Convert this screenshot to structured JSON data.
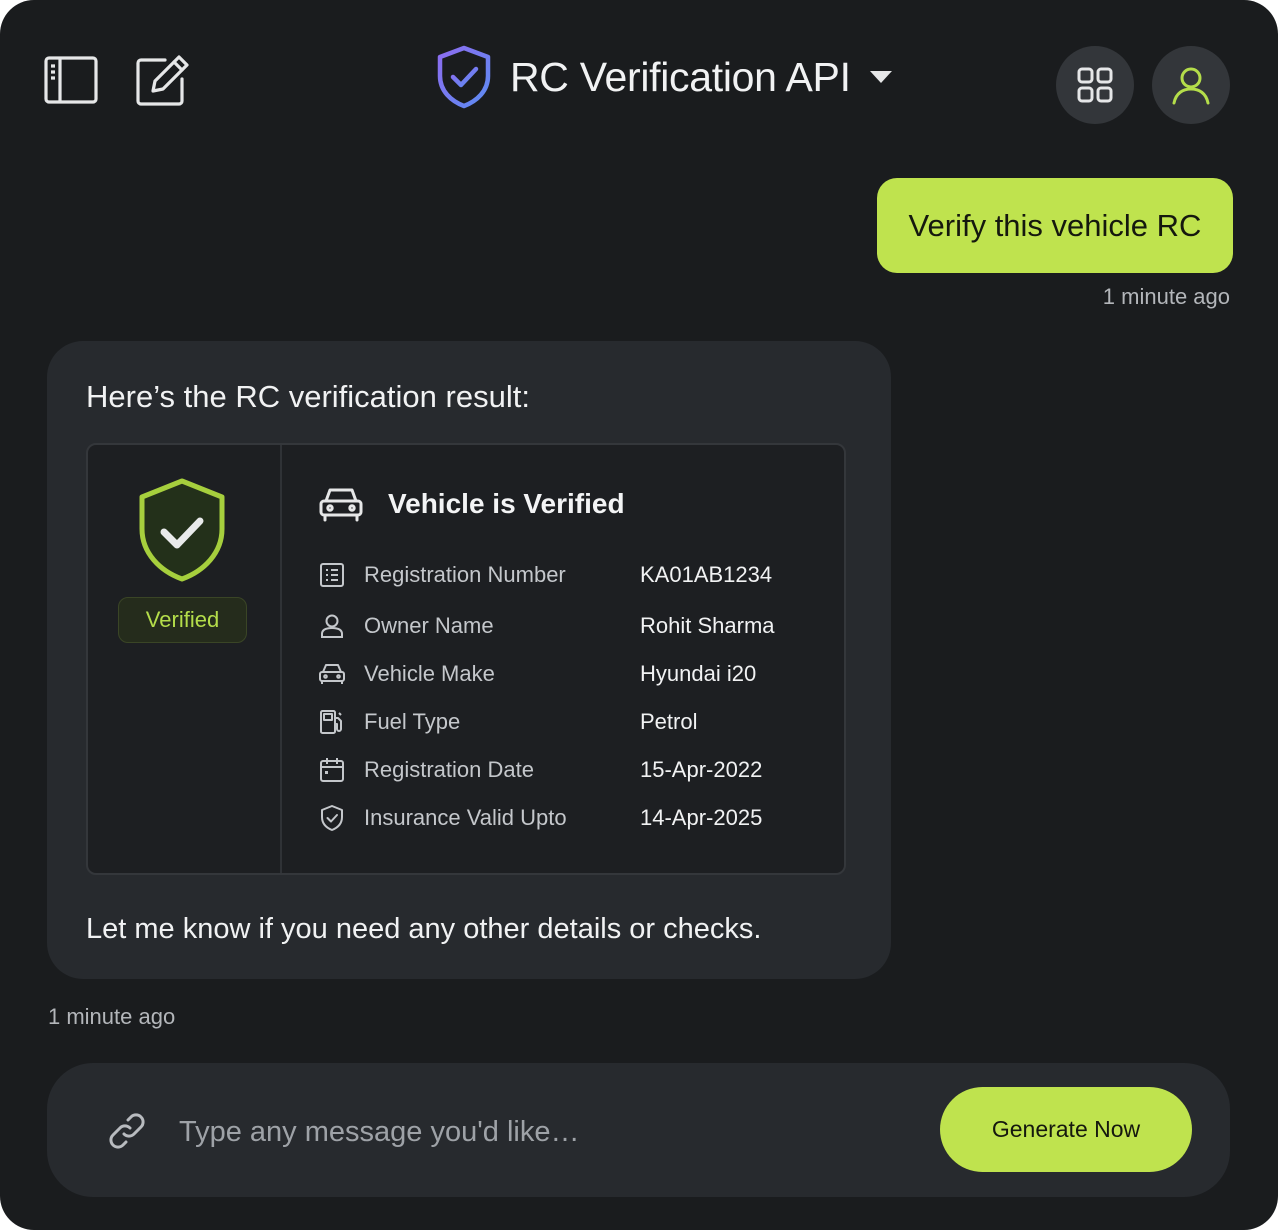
{
  "header": {
    "title": "RC Verification API",
    "icons": {
      "sidebar_toggle": "sidebar-icon",
      "new_chat": "edit-icon",
      "logo": "shield-check-icon",
      "dropdown": "caret-down-icon",
      "apps": "grid-icon",
      "profile": "user-icon"
    }
  },
  "conversation": {
    "user_message": {
      "text": "Verify this vehicle RC",
      "timestamp": "1 minute ago"
    },
    "bot_message": {
      "intro": "Here’s the RC verification result:",
      "outro": "Let me know if you need any other details or checks.",
      "timestamp": "1 minute ago",
      "result": {
        "status_badge": "Verified",
        "heading": "Vehicle is Verified",
        "rows": [
          {
            "icon": "document-icon",
            "label": "Registration Number",
            "value": "KA01AB1234"
          },
          {
            "icon": "user-icon",
            "label": "Owner Name",
            "value": "Rohit Sharma"
          },
          {
            "icon": "car-icon",
            "label": "Vehicle Make",
            "value": "Hyundai i20"
          },
          {
            "icon": "fuel-icon",
            "label": "Fuel Type",
            "value": "Petrol"
          },
          {
            "icon": "calendar-icon",
            "label": "Registration Date",
            "value": "15-Apr-2022"
          },
          {
            "icon": "shield-check-icon",
            "label": "Insurance Valid Upto",
            "value": "14-Apr-2025"
          }
        ]
      }
    }
  },
  "composer": {
    "placeholder": "Type any message you'd like…",
    "value": "",
    "button_label": "Generate Now",
    "attach_icon": "link-icon"
  },
  "colors": {
    "background": "#1a1c1e",
    "card": "#272a2e",
    "accent": "#bfe34e",
    "verified_green": "#b4dd4a"
  }
}
